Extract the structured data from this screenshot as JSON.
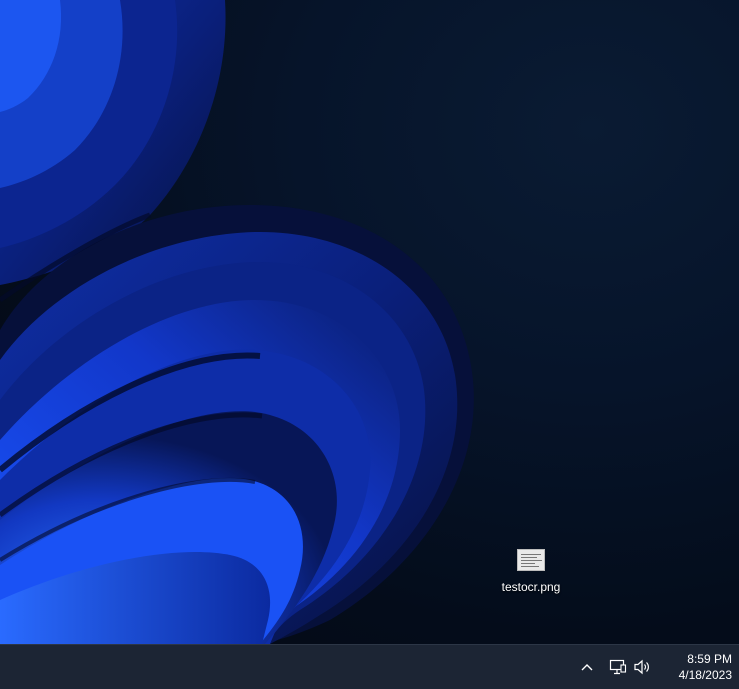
{
  "desktop": {
    "icons": [
      {
        "label": "testocr.png",
        "icon": "image-file-thumbnail-icon"
      }
    ]
  },
  "taskbar": {
    "tray": {
      "chevron_icon": "chevron-up-icon",
      "network_icon": "network-icon",
      "volume_icon": "volume-icon"
    },
    "clock": {
      "time": "8:59 PM",
      "date": "4/18/2023"
    }
  },
  "colors": {
    "wallpaper_background": "#040c1a",
    "wallpaper_accent": "#1846e0",
    "taskbar": "#1c2534",
    "text": "#ffffff"
  }
}
